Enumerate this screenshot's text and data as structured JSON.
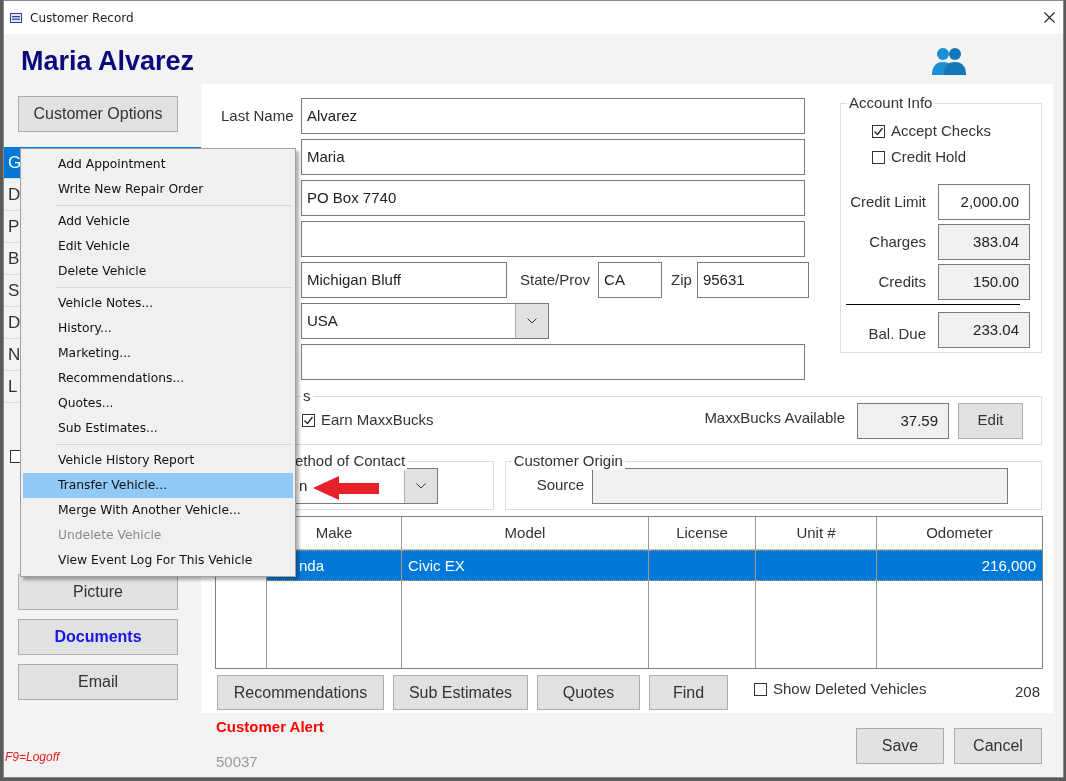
{
  "window": {
    "title": "Customer Record"
  },
  "customer_name": "Maria Alvarez",
  "options_button": "Customer Options",
  "sidebar": {
    "items": [
      {
        "label": "G",
        "selected": true
      },
      {
        "label": "D",
        "selected": false
      },
      {
        "label": "P",
        "selected": false
      },
      {
        "label": "B",
        "selected": false
      },
      {
        "label": "S",
        "selected": false
      },
      {
        "label": "D",
        "selected": false
      },
      {
        "label": "N",
        "selected": false
      },
      {
        "label": "L",
        "selected": false
      }
    ]
  },
  "sidebar_checkbox": {
    "checked": false
  },
  "side_buttons": [
    {
      "label": "Picture",
      "kind": "plain"
    },
    {
      "label": "Documents",
      "kind": "highlight"
    },
    {
      "label": "Email",
      "kind": "plain"
    }
  ],
  "logoff": "F9=Logoff",
  "form": {
    "last_name": {
      "label": "Last Name",
      "value": "Alvarez"
    },
    "first_name": {
      "value": "Maria"
    },
    "address": {
      "value": "PO Box 7740"
    },
    "city": {
      "value": "Michigan Bluff"
    },
    "state": {
      "label": "State/Prov",
      "value": "CA"
    },
    "zip": {
      "label": "Zip",
      "value": "95631"
    },
    "country": {
      "value": "USA"
    }
  },
  "account": {
    "title": "Account Info",
    "checkboxes": [
      {
        "label": "Accept Checks",
        "checked": true
      },
      {
        "label": "Credit Hold",
        "checked": false
      }
    ],
    "amounts": [
      {
        "label": "Credit Limit",
        "value": "2,000.00",
        "editable": true,
        "total": false
      },
      {
        "label": "Charges",
        "value": "383.04",
        "editable": false,
        "total": false
      },
      {
        "label": "Credits",
        "value": "150.00",
        "editable": false,
        "total": false
      },
      {
        "label": "Bal. Due",
        "value": "233.04",
        "editable": false,
        "total": true
      }
    ]
  },
  "maxxbucks": {
    "group_label": "s",
    "earn": {
      "label": "Earn MaxxBucks",
      "checked": true
    },
    "available_label": "MaxxBucks Available",
    "available": "37.59",
    "edit_button": "Edit"
  },
  "contact": {
    "group_label": "ethod of Contact",
    "value": "n"
  },
  "origin": {
    "group_label": "Customer Origin",
    "source_label": "Source"
  },
  "vehicles": {
    "columns": [
      "Make",
      "Model",
      "License",
      "Unit #",
      "Odometer"
    ],
    "rows": [
      {
        "selected": true,
        "make": "nda",
        "model": "Civic EX",
        "odometer": "216,000"
      }
    ]
  },
  "vehicle_buttons": [
    "Recommendations",
    "Sub Estimates",
    "Quotes",
    "Find"
  ],
  "show_deleted": {
    "label": "Show Deleted Vehicles",
    "checked": false
  },
  "vehicle_count": "208",
  "customer_alert": "Customer Alert",
  "customer_id": "50037",
  "buttons": [
    "Save",
    "Cancel"
  ],
  "context_menu": {
    "groups": [
      [
        {
          "label": "Add Appointment",
          "selected": false,
          "disabled": false
        },
        {
          "label": "Write New Repair Order",
          "selected": false,
          "disabled": false
        }
      ],
      [
        {
          "label": "Add Vehicle",
          "selected": false,
          "disabled": false
        },
        {
          "label": "Edit Vehicle",
          "selected": false,
          "disabled": false
        },
        {
          "label": "Delete Vehicle",
          "selected": false,
          "disabled": false
        }
      ],
      [
        {
          "label": "Vehicle Notes...",
          "selected": false,
          "disabled": false
        },
        {
          "label": "History...",
          "selected": false,
          "disabled": false
        },
        {
          "label": "Marketing...",
          "selected": false,
          "disabled": false
        },
        {
          "label": "Recommendations...",
          "selected": false,
          "disabled": false
        },
        {
          "label": "Quotes...",
          "selected": false,
          "disabled": false
        },
        {
          "label": "Sub Estimates...",
          "selected": false,
          "disabled": false
        }
      ],
      [
        {
          "label": "Vehicle History Report",
          "selected": false,
          "disabled": false
        },
        {
          "label": "Transfer Vehicle...",
          "selected": true,
          "disabled": false
        },
        {
          "label": "Merge With Another Vehicle...",
          "selected": false,
          "disabled": false
        },
        {
          "label": "Undelete Vehicle",
          "selected": false,
          "disabled": true
        },
        {
          "label": "View Event Log For This Vehicle",
          "selected": false,
          "disabled": false
        }
      ]
    ]
  }
}
